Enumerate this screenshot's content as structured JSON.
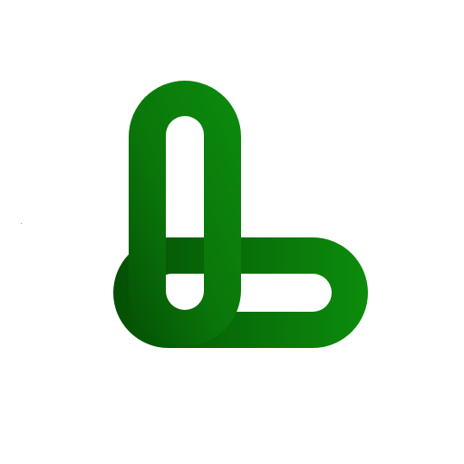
{
  "logo": {
    "icon": "interlocked-l-links-icon",
    "colors": {
      "green_light": "#0c8c0c",
      "green_mid": "#0a760a",
      "green_dark": "#045004",
      "background": "#ffffff"
    }
  }
}
